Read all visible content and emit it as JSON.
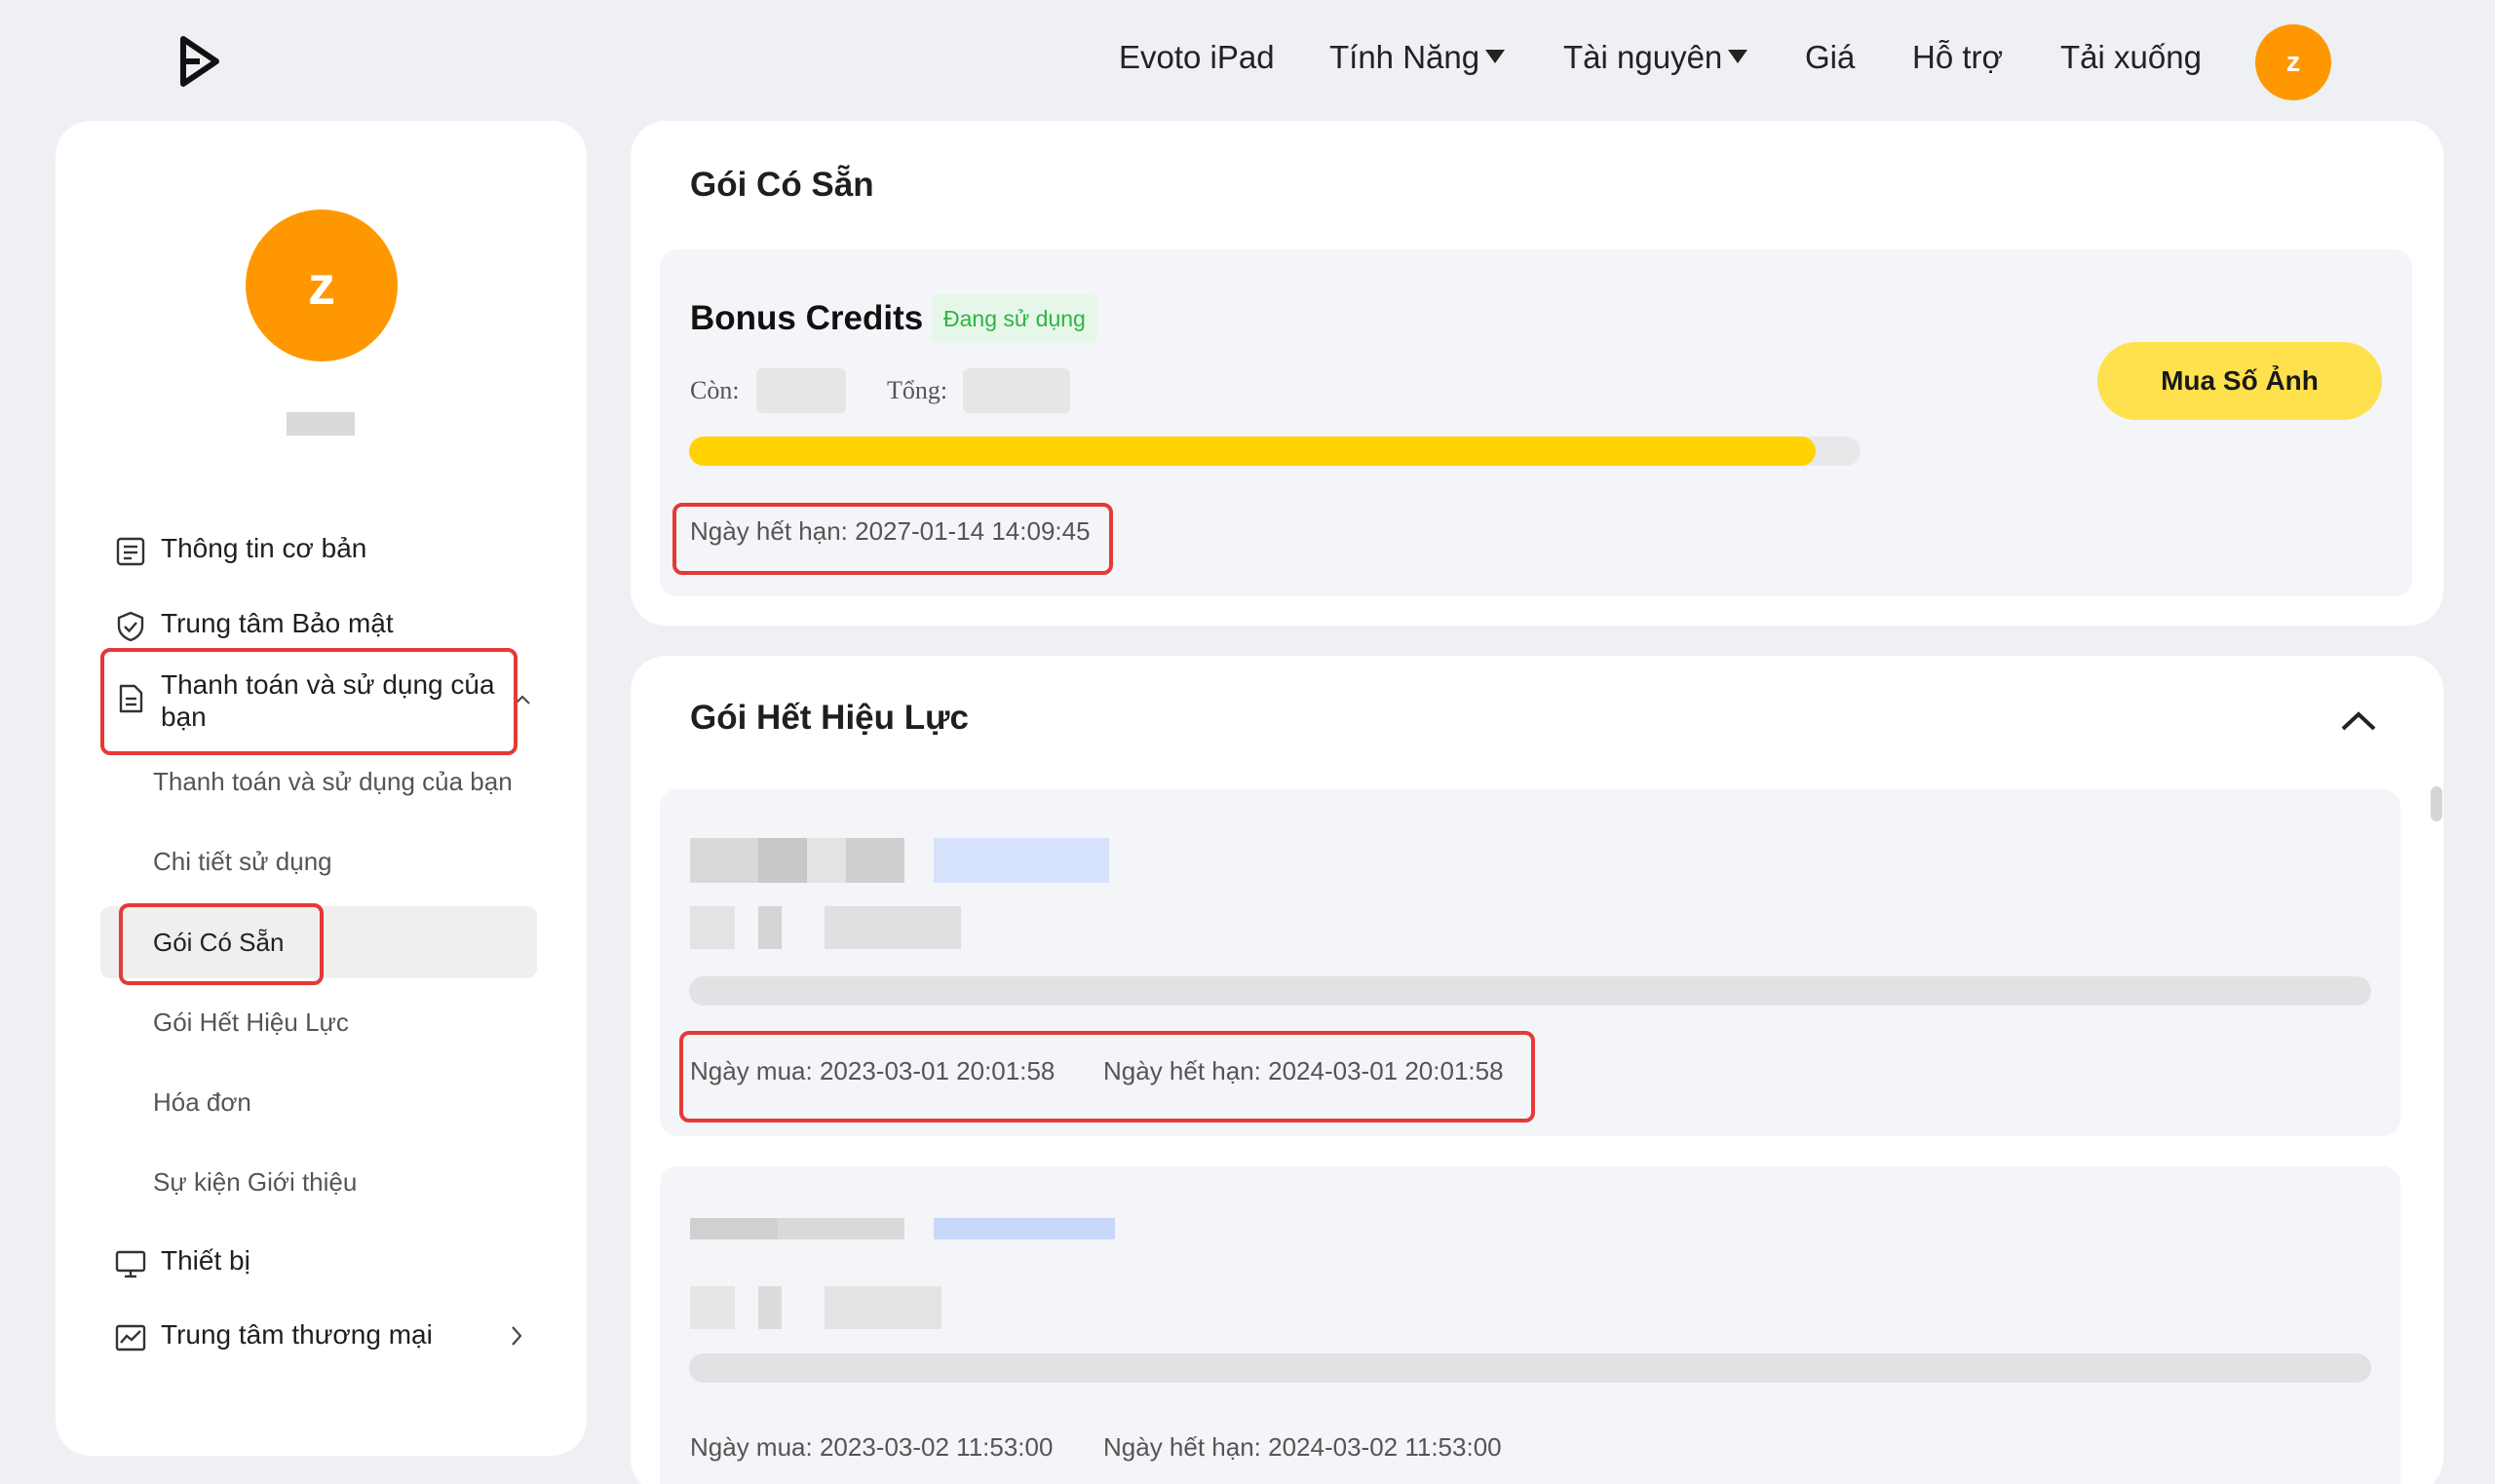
{
  "nav": {
    "items": [
      "Evoto iPad",
      "Tính Năng",
      "Tài nguyên",
      "Giá",
      "Hỗ trợ",
      "Tải xuống"
    ],
    "avatar_letter": "z"
  },
  "sidebar": {
    "avatar_letter": "z",
    "items": {
      "basic_info": "Thông tin cơ bản",
      "security": "Trung tâm Bảo mật",
      "billing": "Thanh toán và sử dụng của bạn",
      "devices": "Thiết bị",
      "commerce": "Trung tâm thương mại"
    },
    "sub_items": [
      "Thanh toán và sử dụng của bạn",
      "Chi tiết sử dụng",
      "Gói Có Sẵn",
      "Gói Hết Hiệu Lực",
      "Hóa đơn",
      "Sự kiện Giới thiệu"
    ],
    "active_sub": "Gói Có Sẵn"
  },
  "available": {
    "title": "Gói Có Sẵn",
    "plan": {
      "name": "Bonus Credits",
      "status": "Đang sử dụng",
      "remaining_label": "Còn:",
      "total_label": "Tổng:",
      "progress": 0.962,
      "expiry": "Ngày hết hạn: 2027-01-14 14:09:45"
    },
    "buy_button": "Mua Số Ảnh"
  },
  "expired": {
    "title": "Gói Hết Hiệu Lực",
    "plans": [
      {
        "purchase": "Ngày mua: 2023-03-01 20:01:58",
        "expiry": "Ngày hết hạn: 2024-03-01 20:01:58"
      },
      {
        "purchase": "Ngày mua: 2023-03-02 11:53:00",
        "expiry": "Ngày hết hạn: 2024-03-02 11:53:00"
      }
    ]
  },
  "colors": {
    "accent": "#ff9800",
    "progress": "#ffd200",
    "buy_button": "#ffe14d",
    "badge_text": "#2fb344",
    "highlight": "#e53935"
  }
}
